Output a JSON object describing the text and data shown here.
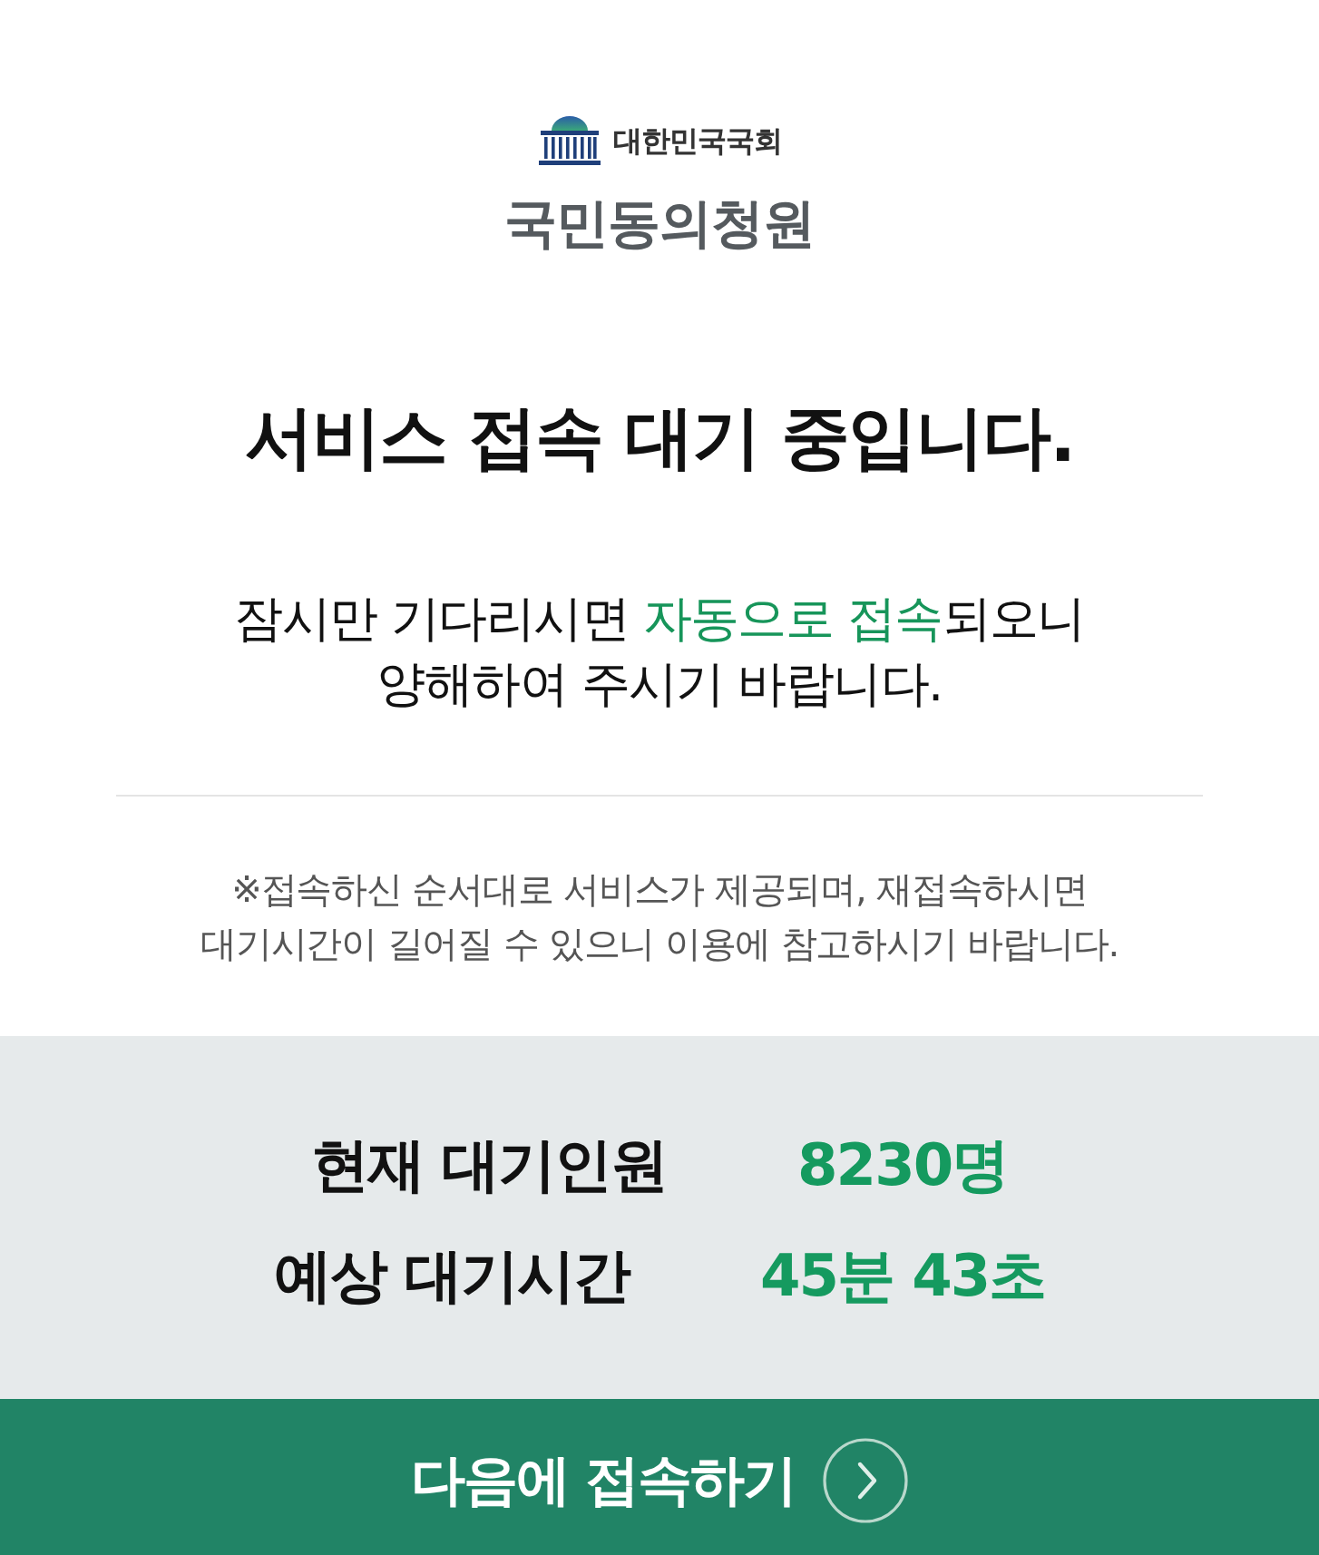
{
  "header": {
    "organization": "대한민국국회",
    "service_name": "국민동의청원"
  },
  "title": "서비스 접속 대기 중입니다.",
  "message": {
    "parts": [
      {
        "text": "잠시만 기다리시면 ",
        "highlight": false
      },
      {
        "text": "자동으로 접속",
        "highlight": true
      },
      {
        "text": "되오니\n양해하여 주시기 바랍니다.",
        "highlight": false
      }
    ]
  },
  "notice": "※접속하신 순서대로 서비스가 제공되며, 재접속하시면\n대기시간이 길어질 수 있으니 이용에 참고하시기 바랍니다.",
  "queue_info": [
    {
      "label": "현재 대기인원",
      "value": "8230명"
    },
    {
      "label": "예상 대기시간",
      "value": "45분 43초"
    }
  ],
  "button": {
    "label": "다음에 접속하기"
  }
}
